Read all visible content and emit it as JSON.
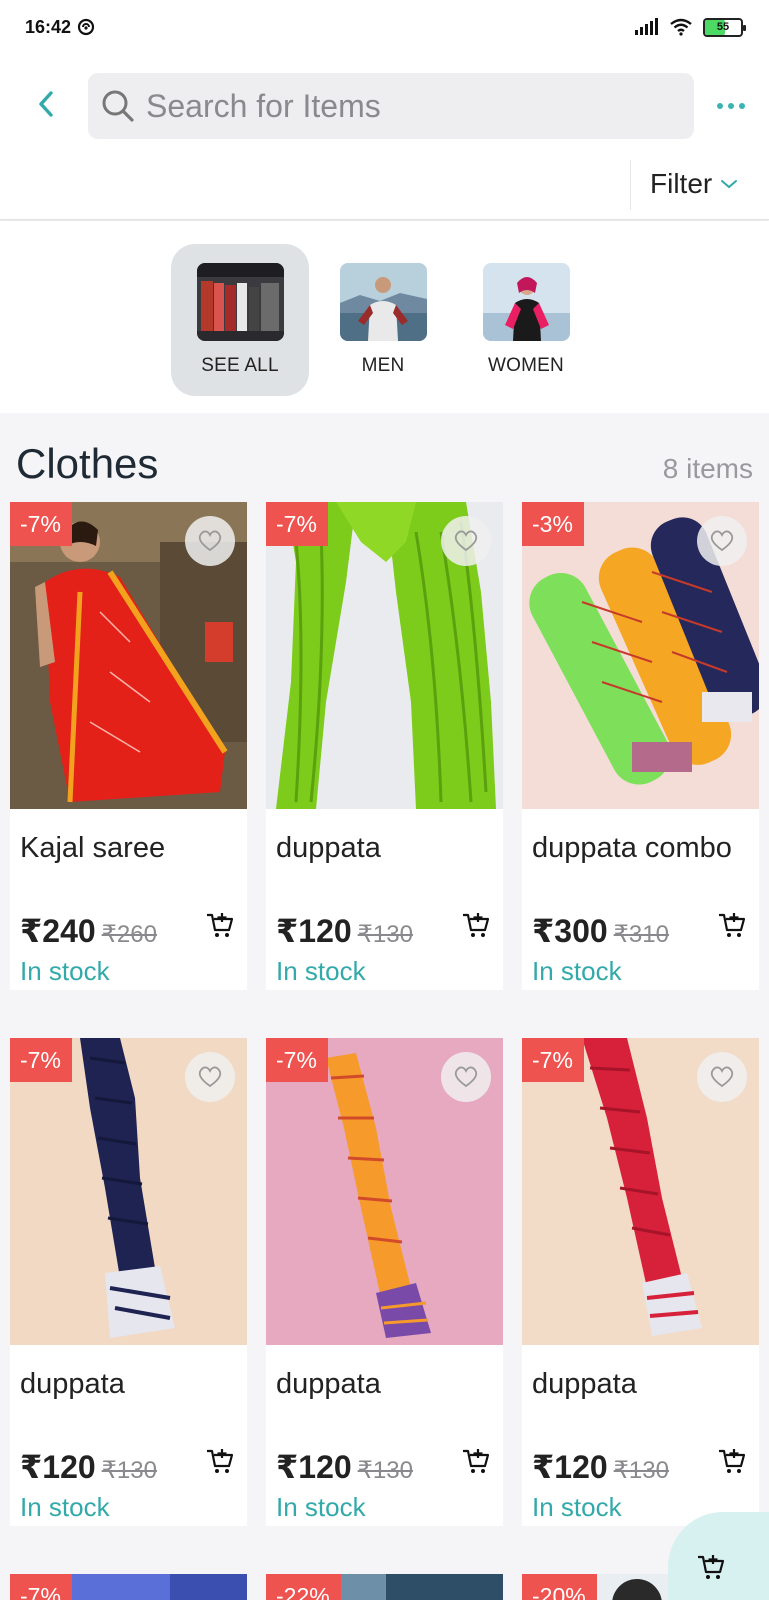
{
  "status": {
    "time": "16:42",
    "battery": "55",
    "battery_level": 0.55
  },
  "search": {
    "placeholder": "Search for Items"
  },
  "header": {
    "filter_label": "Filter"
  },
  "categories": [
    {
      "label": "SEE ALL",
      "active": true
    },
    {
      "label": "MEN",
      "active": false
    },
    {
      "label": "WOMEN",
      "active": false
    }
  ],
  "section": {
    "title": "Clothes",
    "count": "8 items"
  },
  "products": [
    {
      "discount": "-7%",
      "name": "Kajal saree",
      "price": "₹240",
      "mrp": "₹260",
      "stock": "In stock"
    },
    {
      "discount": "-7%",
      "name": "duppata",
      "price": "₹120",
      "mrp": "₹130",
      "stock": "In stock"
    },
    {
      "discount": "-3%",
      "name": "duppata combo",
      "price": "₹300",
      "mrp": "₹310",
      "stock": "In stock"
    },
    {
      "discount": "-7%",
      "name": "duppata",
      "price": "₹120",
      "mrp": "₹130",
      "stock": "In stock"
    },
    {
      "discount": "-7%",
      "name": "duppata",
      "price": "₹120",
      "mrp": "₹130",
      "stock": "In stock"
    },
    {
      "discount": "-7%",
      "name": "duppata",
      "price": "₹120",
      "mrp": "₹130",
      "stock": "In stock"
    }
  ],
  "partial_row": [
    {
      "discount": "-7%"
    },
    {
      "discount": "-22%"
    },
    {
      "discount": "-20%"
    }
  ],
  "colors": {
    "accent": "#33a9a9",
    "badge": "#ef5350",
    "fab": "#d7f1f1"
  }
}
